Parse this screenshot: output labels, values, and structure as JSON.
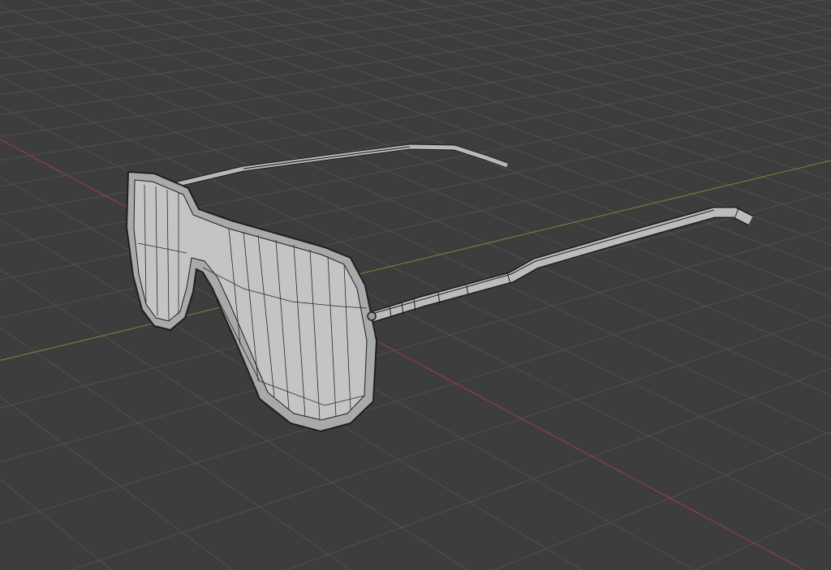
{
  "viewport": {
    "mode": "wireframe-overlay",
    "colors": {
      "background": "#3d3d3d",
      "grid": "#505050",
      "x_axis": "#8e3e47",
      "y_axis": "#62853a",
      "mesh_fill": "#b4b4b4",
      "mesh_fill_light": "#c6c6c6",
      "wire": "#1e1e1e"
    }
  },
  "object": {
    "icon": "glasses-mesh"
  }
}
